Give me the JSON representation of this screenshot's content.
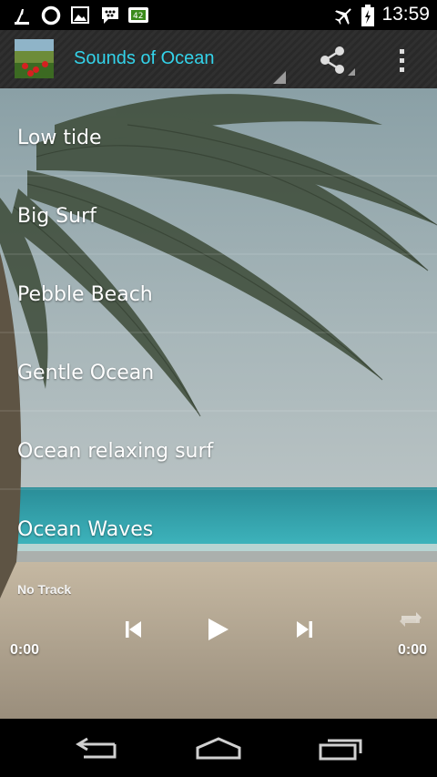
{
  "status_bar": {
    "time": "13:59",
    "left_icons": [
      "cleaner-icon",
      "circle-icon",
      "image-icon",
      "bbm-icon",
      "battery-widget-icon"
    ],
    "right_icons": [
      "airplane-mode-icon",
      "battery-charging-icon"
    ]
  },
  "action_bar": {
    "title": "Sounds of Ocean",
    "title_color": "#33d3ea",
    "icons": [
      "app-icon",
      "share-icon",
      "overflow-menu-icon"
    ]
  },
  "tracks": [
    {
      "label": "Low tide"
    },
    {
      "label": "Big Surf"
    },
    {
      "label": "Pebble Beach"
    },
    {
      "label": "Gentle Ocean"
    },
    {
      "label": "Ocean relaxing surf"
    },
    {
      "label": "Ocean Waves"
    }
  ],
  "player": {
    "now_playing": "No Track",
    "elapsed": "0:00",
    "duration": "0:00",
    "controls": [
      "previous-icon",
      "play-icon",
      "next-icon",
      "repeat-icon"
    ]
  },
  "nav_bar": {
    "buttons": [
      "back-icon",
      "home-icon",
      "recents-icon"
    ]
  }
}
